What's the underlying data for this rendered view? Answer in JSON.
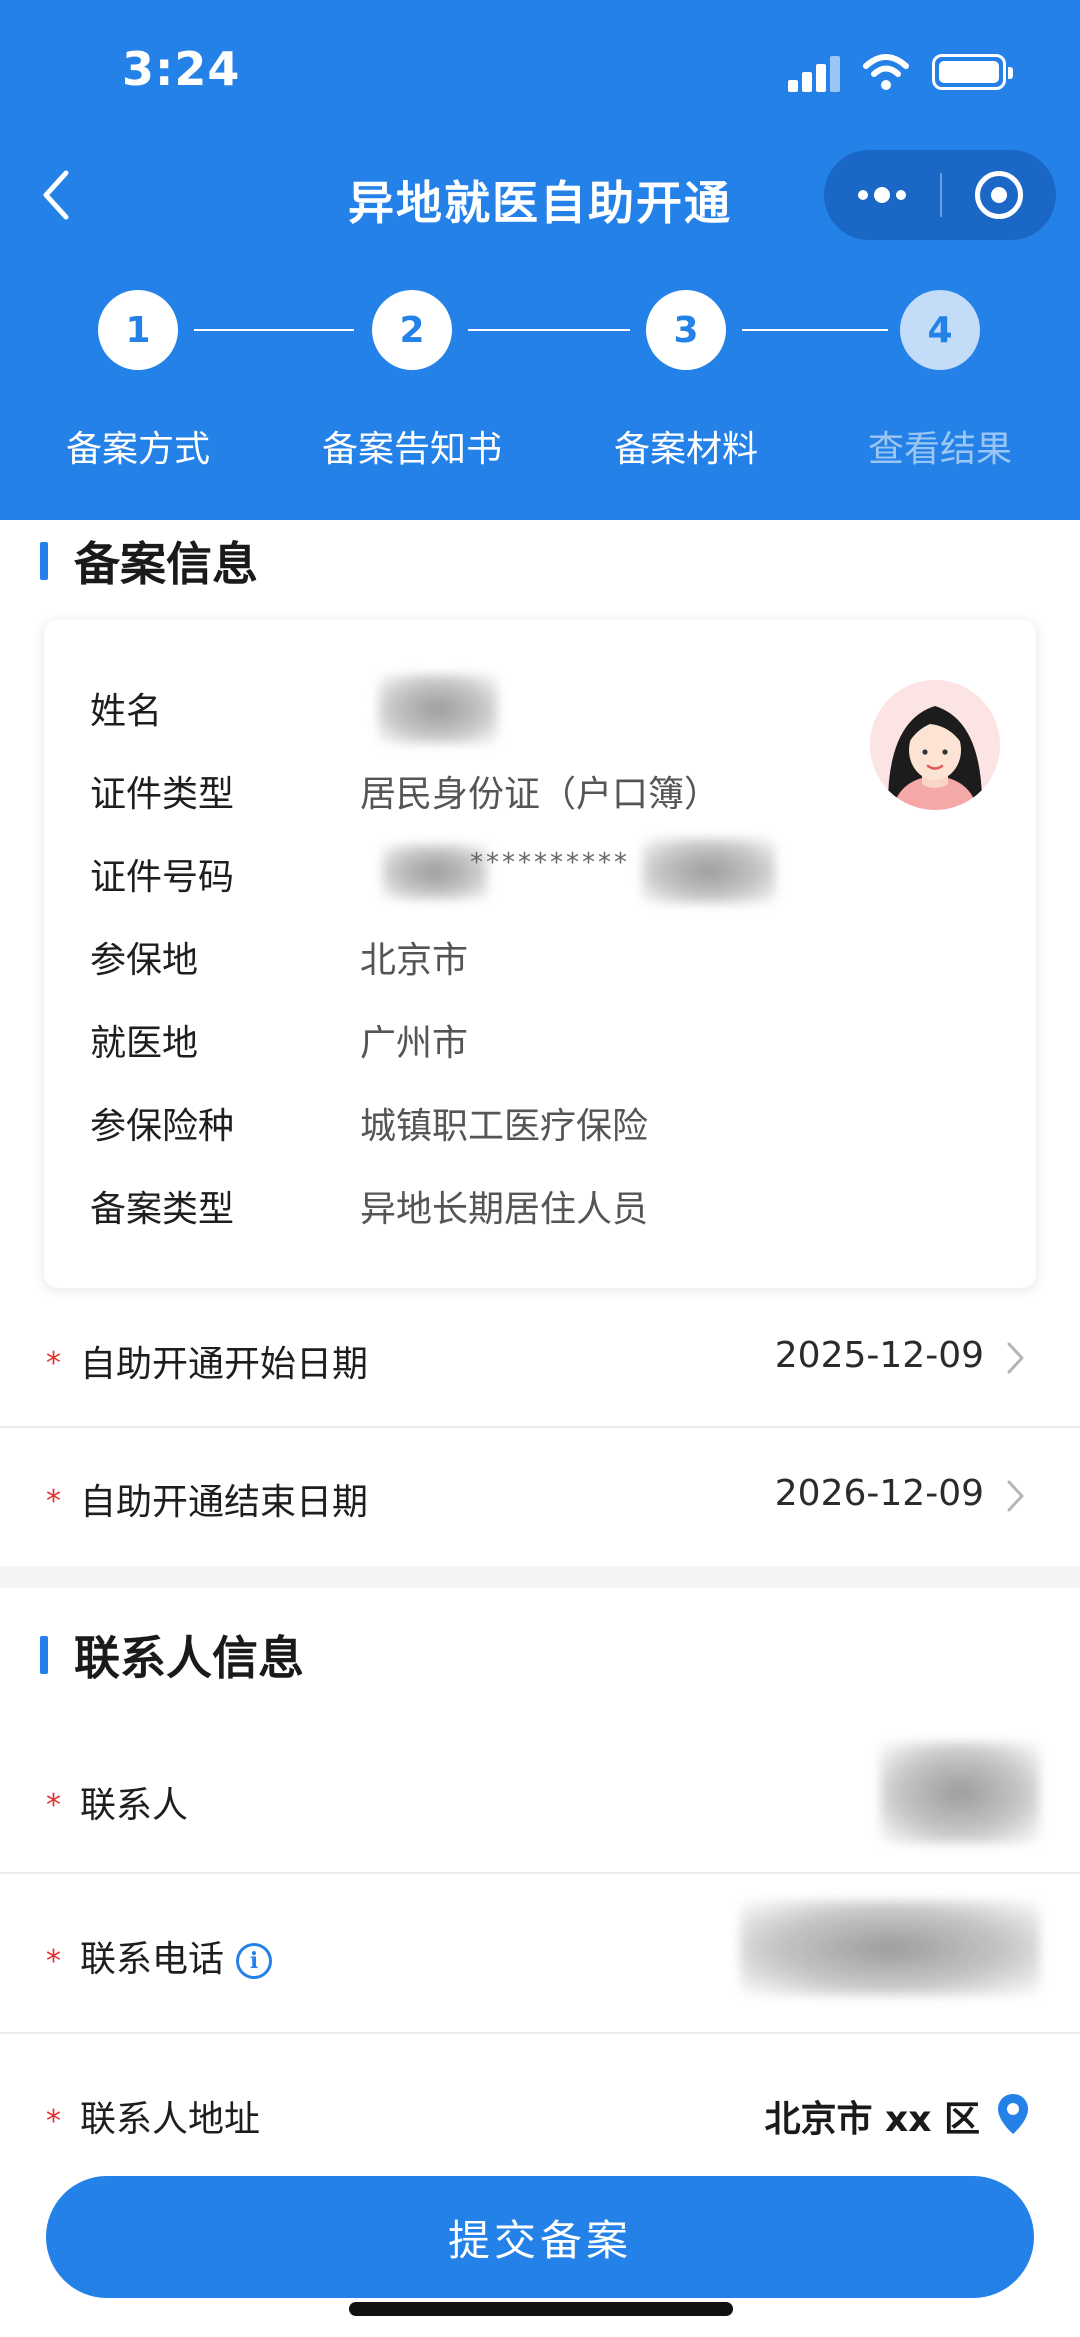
{
  "status_bar": {
    "time": "3:24"
  },
  "nav": {
    "title": "异地就医自助开通"
  },
  "steps": [
    {
      "number": "1",
      "label": "备案方式",
      "active": true
    },
    {
      "number": "2",
      "label": "备案告知书",
      "active": true
    },
    {
      "number": "3",
      "label": "备案材料",
      "active": true
    },
    {
      "number": "4",
      "label": "查看结果",
      "active": false
    }
  ],
  "record_info": {
    "title": "备案信息",
    "rows": [
      {
        "label": "姓名",
        "value": ""
      },
      {
        "label": "证件类型",
        "value": "居民身份证（户口簿）"
      },
      {
        "label": "证件号码",
        "value": "**********"
      },
      {
        "label": "参保地",
        "value": "北京市"
      },
      {
        "label": "就医地",
        "value": "广州市"
      },
      {
        "label": "参保险种",
        "value": "城镇职工医疗保险"
      },
      {
        "label": "备案类型",
        "value": "异地长期居住人员"
      }
    ]
  },
  "dates": {
    "start": {
      "label": "自助开通开始日期",
      "value": "2025-12-09"
    },
    "end": {
      "label": "自助开通结束日期",
      "value": "2026-12-09"
    }
  },
  "contact": {
    "title": "联系人信息",
    "name_label": "联系人",
    "phone_label": "联系电话",
    "address_label": "联系人地址",
    "address_value": "北京市 xx 区"
  },
  "submit_label": "提交备案",
  "required_mark": "*",
  "colors": {
    "primary": "#2381e7",
    "required": "#e0322e"
  }
}
